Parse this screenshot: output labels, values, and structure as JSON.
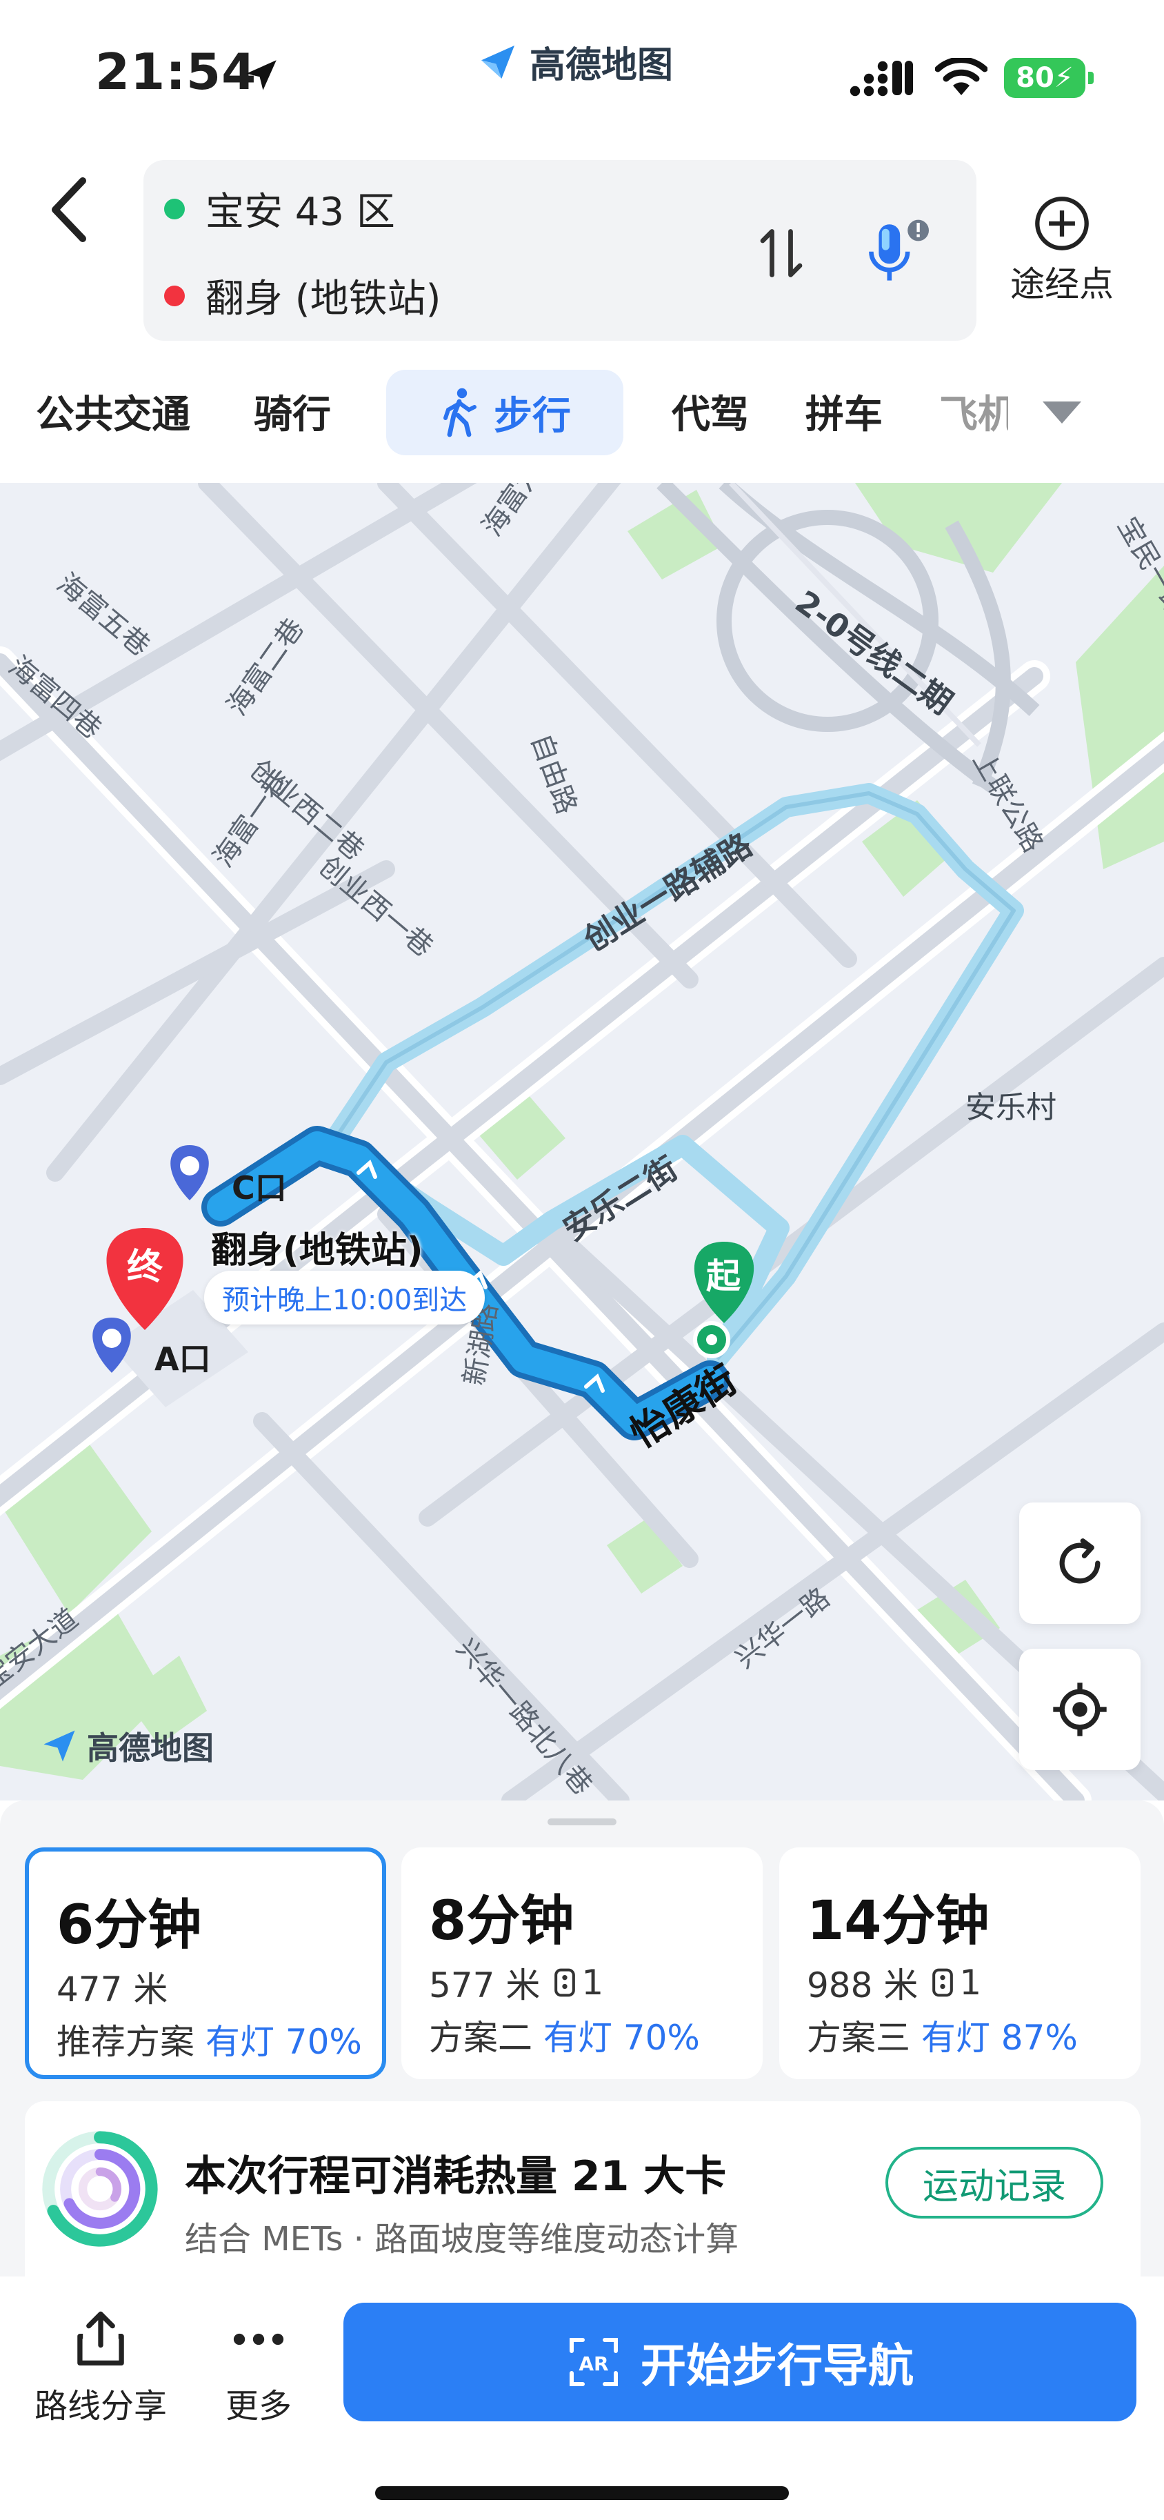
{
  "status_bar": {
    "time": "21:54",
    "app_name": "高德地图",
    "battery": "80"
  },
  "route": {
    "origin": "宝安 43 区",
    "destination": "翻身 (地铁站)",
    "via_label": "途经点"
  },
  "tabs": [
    {
      "label": "公共交通"
    },
    {
      "label": "骑行"
    },
    {
      "label": "步行",
      "active": true
    },
    {
      "label": "代驾"
    },
    {
      "label": "拼车"
    },
    {
      "label": "飞机"
    }
  ],
  "map": {
    "road_labels": [
      "海富五巷",
      "海富四巷",
      "海富二巷",
      "海富一巷",
      "创业西二巷",
      "创业西一巷",
      "自由路",
      "创业一路辅路",
      "2-0号线二期",
      "宝民一路",
      "上联公路",
      "安乐村",
      "安乐二街",
      "怡康街",
      "兴华一路",
      "兴华一路北八巷",
      "宝安大道",
      "海富六巷",
      "新湖路"
    ],
    "pins": {
      "c_exit": "C口",
      "a_exit": "A口",
      "end": "终",
      "start": "起"
    },
    "destination_label": "翻身(地铁站)",
    "eta": "预计晚上10:00到达",
    "watermark": "高德地图"
  },
  "options": [
    {
      "duration": "6分钟",
      "distance": "477 米",
      "lights": "",
      "plan": "推荐方案",
      "light_info": "有灯 70%",
      "selected": true
    },
    {
      "duration": "8分钟",
      "distance": "577 米",
      "lights": "1",
      "plan": "方案二",
      "light_info": "有灯 70%"
    },
    {
      "duration": "14分钟",
      "distance": "988 米",
      "lights": "1",
      "plan": "方案三",
      "light_info": "有灯 87%"
    }
  ],
  "calorie": {
    "title": "本次行程可消耗热量 21 大卡",
    "subtitle": "结合 METs · 路面坡度等维度动态计算",
    "button": "运动记录"
  },
  "actions": {
    "share": "路线分享",
    "more": "更多",
    "navigate": "开始步行导航"
  },
  "colors": {
    "accent": "#2b7ff5",
    "route_primary": "#2a9ce8",
    "route_alt": "#a8daf0",
    "origin_green": "#1ec276",
    "dest_red": "#f2333f"
  }
}
